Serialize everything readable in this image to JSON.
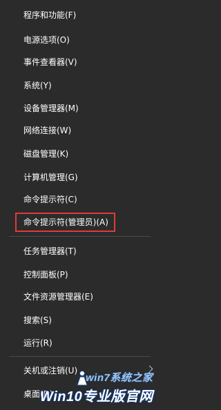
{
  "menu": {
    "items": [
      {
        "label": "程序和功能(F)"
      },
      {
        "label": "电源选项(O)"
      },
      {
        "label": "事件查看器(V)"
      },
      {
        "label": "系统(Y)"
      },
      {
        "label": "设备管理器(M)"
      },
      {
        "label": "网络连接(W)"
      },
      {
        "label": "磁盘管理(K)"
      },
      {
        "label": "计算机管理(G)"
      },
      {
        "label": "命令提示符(C)"
      },
      {
        "label": "命令提示符(管理员)(A)",
        "highlighted": true
      },
      {
        "label": "任务管理器(T)"
      },
      {
        "label": "控制面板(P)"
      },
      {
        "label": "文件资源管理器(E)"
      },
      {
        "label": "搜索(S)"
      },
      {
        "label": "运行(R)"
      },
      {
        "label": "关机或注销(U)",
        "has_submenu": true
      },
      {
        "label": "桌面(D)"
      }
    ]
  },
  "colors": {
    "background": "#2b2b2b",
    "text": "#ffffff",
    "highlight_border": "#e23a3a",
    "separator": "#4a4a4a"
  },
  "watermark": {
    "top": "win7系统之家",
    "bottom": "Win10专业版官网"
  }
}
